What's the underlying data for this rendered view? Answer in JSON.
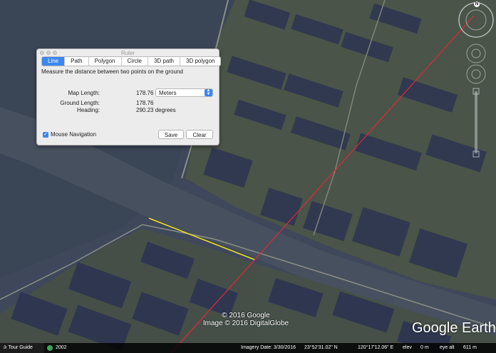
{
  "ruler": {
    "window_title": "Ruler",
    "tabs": [
      "Line",
      "Path",
      "Polygon",
      "Circle",
      "3D path",
      "3D polygon"
    ],
    "active_tab": "Line",
    "description": "Measure the distance between two points on the ground",
    "map_length_label": "Map Length:",
    "map_length_value": "178.76",
    "unit": "Meters",
    "ground_length_label": "Ground Length:",
    "ground_length_value": "178.76",
    "heading_label": "Heading:",
    "heading_value": "290.23 degrees",
    "mouse_navigation_label": "Mouse Navigation",
    "mouse_navigation_checked": true,
    "save_label": "Save",
    "clear_label": "Clear"
  },
  "map": {
    "copyright_line1": "© 2016 Google",
    "copyright_line2": "Image © 2016 DigitalGlobe",
    "logo": "Google Earth",
    "compass_letter": "N",
    "measure_line_color": "#f0e020",
    "heading_line_color": "#e0283a"
  },
  "statusbar": {
    "tour_guide": "✰ Tour Guide",
    "historical_year": "2002",
    "imagery_date": "Imagery Date: 3/30/2016",
    "latitude": "23°52'31.02\" N",
    "longitude": "120°17'12.06\" E",
    "elev_label": "elev",
    "elev_value": "0 m",
    "eye_alt_label": "eye alt",
    "eye_alt_value": "611 m"
  }
}
